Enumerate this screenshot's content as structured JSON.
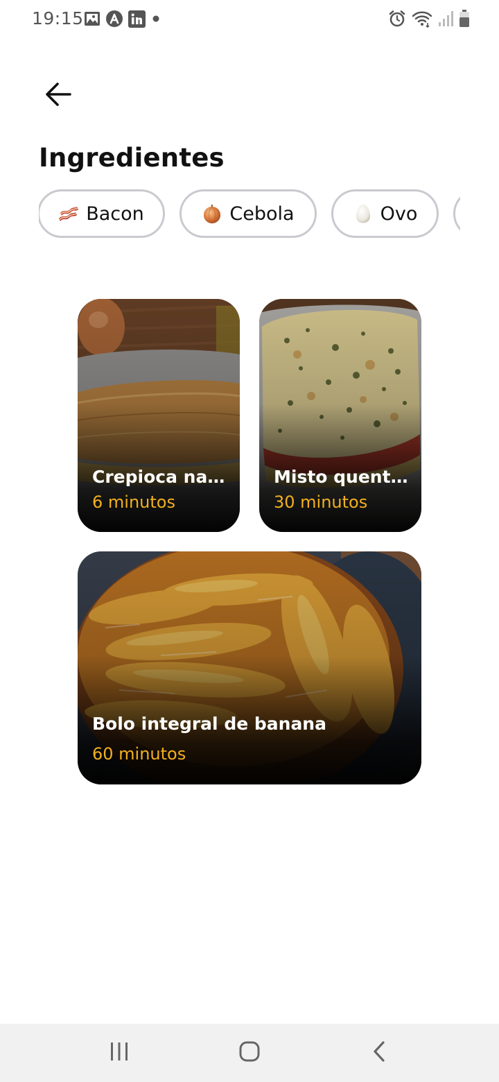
{
  "status_bar": {
    "time": "19:15",
    "left_icons": [
      "image-icon",
      "app-a-icon",
      "linkedin-icon",
      "dot-icon"
    ],
    "right_icons": [
      "alarm-icon",
      "wifi-icon",
      "signal-icon",
      "battery-icon"
    ]
  },
  "header": {
    "back_icon": "arrow-left-icon",
    "title": "Ingredientes"
  },
  "ingredients": [
    {
      "label": "Bacon",
      "icon": "bacon-icon"
    },
    {
      "label": "Cebola",
      "icon": "onion-icon"
    },
    {
      "label": "Ovo",
      "icon": "egg-icon"
    },
    {
      "label": "",
      "icon": ""
    }
  ],
  "recipes": [
    {
      "name": "Crepioca na frigideira",
      "time": "6 minutos"
    },
    {
      "name": "Misto quente de forno",
      "time": "30 minutos"
    },
    {
      "name": "Bolo integral de banana",
      "time": "60 minutos"
    }
  ],
  "nav_bar": {
    "buttons": [
      "recents-icon",
      "home-icon",
      "back-icon"
    ]
  },
  "colors": {
    "accent": "#f2b01e",
    "chip_border": "#c9c9cf",
    "nav_background": "#f1f1f1"
  }
}
